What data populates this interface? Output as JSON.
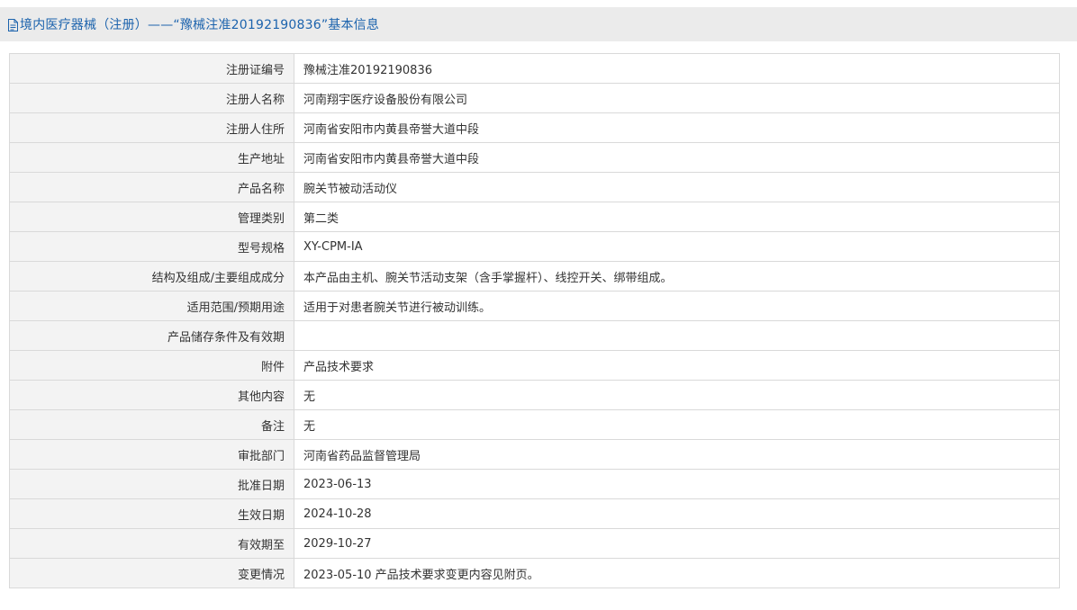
{
  "header": {
    "title": "境内医疗器械（注册）——“豫械注准20192190836”基本信息",
    "icon": "document-icon"
  },
  "rows": [
    {
      "label": "注册证编号",
      "value": "豫械注准20192190836"
    },
    {
      "label": "注册人名称",
      "value": "河南翔宇医疗设备股份有限公司"
    },
    {
      "label": "注册人住所",
      "value": "河南省安阳市内黄县帝誉大道中段"
    },
    {
      "label": "生产地址",
      "value": "河南省安阳市内黄县帝誉大道中段"
    },
    {
      "label": "产品名称",
      "value": "腕关节被动活动仪"
    },
    {
      "label": "管理类别",
      "value": "第二类"
    },
    {
      "label": "型号规格",
      "value": "XY-CPM-IA"
    },
    {
      "label": "结构及组成/主要组成成分",
      "value": "本产品由主机、腕关节活动支架（含手掌握杆）、线控开关、绑带组成。"
    },
    {
      "label": "适用范围/预期用途",
      "value": "适用于对患者腕关节进行被动训练。"
    },
    {
      "label": "产品储存条件及有效期",
      "value": ""
    },
    {
      "label": "附件",
      "value": "产品技术要求"
    },
    {
      "label": "其他内容",
      "value": "无"
    },
    {
      "label": "备注",
      "value": "无"
    },
    {
      "label": "审批部门",
      "value": "河南省药品监督管理局"
    },
    {
      "label": "批准日期",
      "value": "2023-06-13"
    },
    {
      "label": "生效日期",
      "value": "2024-10-28"
    },
    {
      "label": "有效期至",
      "value": "2029-10-27"
    },
    {
      "label": "变更情况",
      "value": "2023-05-10 产品技术要求变更内容见附页。"
    }
  ],
  "colors": {
    "title": "#1c63ad",
    "header_bg": "#ebebeb",
    "label_bg": "#f3f3f3",
    "border": "#d9d9d9",
    "text": "#333333"
  }
}
